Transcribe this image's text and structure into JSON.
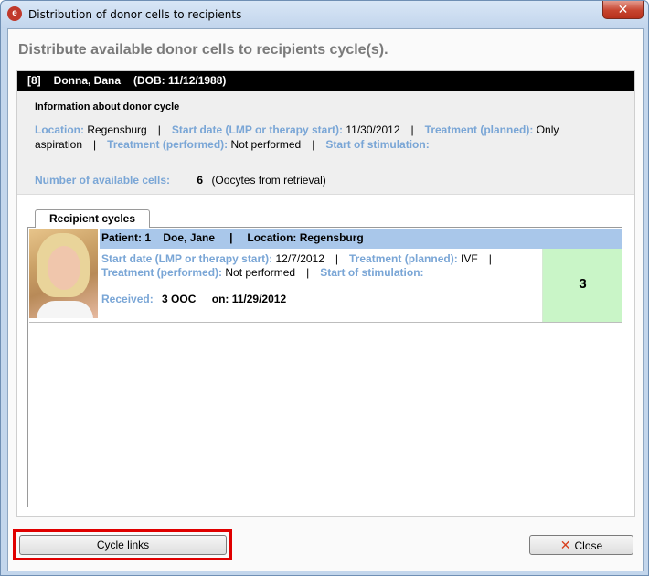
{
  "window": {
    "title": "Distribution of donor cells to recipients",
    "close_glyph": "✕"
  },
  "page_title": "Distribute available donor cells to recipients cycle(s).",
  "donor": {
    "id": "[8]",
    "name": "Donna, Dana",
    "dob": "(DOB: 11/12/1988)",
    "info_title": "Information about donor cycle",
    "location_label": "Location:",
    "location": "Regensburg",
    "start_date_label": "Start date (LMP or therapy start):",
    "start_date": "11/30/2012",
    "treatment_planned_label": "Treatment (planned):",
    "treatment_planned_a": "Only",
    "treatment_planned_b": "aspiration",
    "treatment_performed_label": "Treatment (performed):",
    "treatment_performed": "Not performed",
    "start_stim_label": "Start of stimulation:",
    "available_label": "Number of available cells:",
    "available_count": "6",
    "available_note": "(Oocytes from retrieval)",
    "separator": "|"
  },
  "tab": {
    "label": "Recipient cycles"
  },
  "recipient": {
    "patient_label": "Patient: 1",
    "name": "Doe, Jane",
    "location": "Location: Regensburg",
    "start_date_label": "Start date (LMP or therapy start):",
    "start_date": "12/7/2012",
    "treatment_planned_label": "Treatment (planned):",
    "treatment_planned": "IVF",
    "treatment_performed_label": "Treatment (performed):",
    "treatment_performed": "Not performed",
    "start_stim_label": "Start of stimulation:",
    "received_label": "Received:",
    "received_value": "3 OOC",
    "on_label": "on:",
    "received_date": "11/29/2012",
    "assigned_count": "3",
    "separator": "|"
  },
  "buttons": {
    "cycle_links": "Cycle links",
    "close": "Close",
    "close_glyph": "✕"
  },
  "colors": {
    "label_blue": "#7aa6d6",
    "recipient_header": "#a9c7ea",
    "count_cell": "#c9f5c7",
    "highlight_red": "#e00000"
  }
}
